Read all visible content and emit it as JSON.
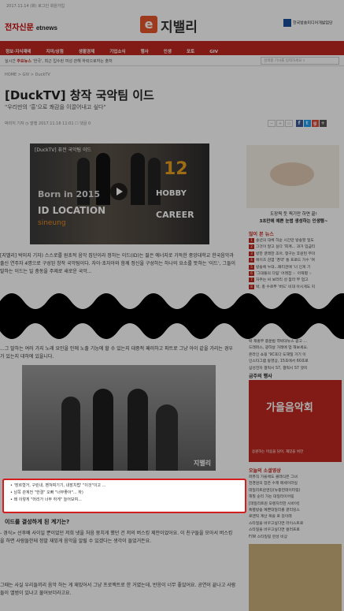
{
  "topbar": {
    "text": "2017.11.14 (화) 로그인 회원가입"
  },
  "header": {
    "etnews_logo": "전자신문",
    "etnews_sub": "etnews",
    "jibelli_mark": "e",
    "jibelli_name": "지밸리",
    "kocca": "한국방송미디어개발업단"
  },
  "nav": {
    "items": [
      "정보·지식재테",
      "지미/상점",
      "생활경제",
      "기업소식",
      "행사",
      "인생",
      "포토",
      "GIV"
    ]
  },
  "subnav": {
    "label": "실시간",
    "highlight": "주요뉴스",
    "text": "'한국', 최근 입수된 여성 관해 하락으로하는 출처",
    "search_placeholder": "검색할 기사를 입력하세요"
  },
  "breadcrumb": "HOME  >  GIV  >  DuckTV",
  "article": {
    "title": "[DuckTV] 창작 국악팀 이드",
    "subtitle": "\"우리만의 '흥'으로 쾌감을 이끌어내고 싶다\"",
    "meta": "박미지 기자   ◷ 발행 2017.11.16 11:01   ☐ 댓글 0",
    "video_title": "[DuckTV] 퓨전 국악팀 이드",
    "video_born": "Born in 2015",
    "video_id": "ID LOCATION",
    "video_sub": "sineung",
    "video_hobby": "HOBBY",
    "video_career": "CAREER",
    "video_num": "12",
    "paragraph1": "[지밸리] 박미지 기자) 스스로를 원초적 음악 집단이라 정하는 이드(ID)는 젊은 에너지로 가득한 중앙대학교 한국음악과 출신 연주자 4명으로 구성된 창작 국악팀이다. 자아·초자아와 함께 정신을 구성하는 하나의 요소를 뜻하는 '이드', 그들이 말하는 이드는 일 충동을 주제로 새로운 국악...",
    "paragraph2": "...그 말하는 여러 가지 노래 요인을 인에 노출 기능에 할 수 있는지 대중적 패러하고 파트로 그냥 아이 같을 가리는 경우가 있는지 대하에 있을니다.",
    "captions": [
      "'장르형거, 구린내, 벤쳐찌기기, 내장치법' \"이것\"이고 ...",
      "남쪽 관계전 \"한결\" 오빠 \"너무좋아\"... 하)",
      "왜 이렇게 \"머리가 너무 하게\" 늘어보여..."
    ],
    "section_heading": "이드를 결성하게 된 계기는?",
    "paragraph3": "- 경식> 선후배 사이일 뿐이었던 저희 넷을 처음 뭉치게 했던 건 저의 버스킹 제안이었어요. 이 친구들을 모아서 버스킹을 하면 사람들한테 정말 재밌게 음악을 알릴 수 있겠다는 생각이 들었거든요.",
    "paragraph4": "그때는 사실 우리들끼리 음악 하는 게 재밌어서 그냥 프로젝트로 한 거였는데, 반응이 너무 좋았어요. 공연이 끝나고 사람들이 앨범이 있냐고 물어보더라고요."
  },
  "sidebar": {
    "ad_title_1": "도장찍 듯 찍기만 하면 끝!",
    "ad_title_2": "3초만에 예쁜 눈썹 생성하는 인생템~",
    "popular_heading": "많이 본 뉴스",
    "popular": [
      "송년의 대체 하순 시간만 방송할 일도",
      "그것이 알고 싶다 '회계... 과거 입금티",
      "방한 글래한 조아, 항구는 후원된 무미",
      "에이즈 감염 '경약' 통 프로드 가수 '여",
      "방송에 누대...패티관에 '너 인게 기",
      "'그대들의 다림' 어레잡 ☞ 아재별 ☞",
      "자주는 씨 보라리 성 참라 부 업고",
      "박, 총 수르부 '버드' 비대 아시게도 지"
    ],
    "popular2": [
      "박 재홍부 중문법 역박대뉴스 광고 ...",
      "드래퍼스, 광하날 거래에 업 해보세요.",
      "온라인 쇼핑 '9C포다 도해밀 거기 이",
      "인스타그램 동영상, 15초에서 60초로",
      "삼성전자 갤럭시 S7, 갤럭시 S7 엣지",
      "케이아이비로 'ABS플러스'시스템",
      "실시간 '피조나니' 가입사 로 놀림"
    ],
    "promo_heading": "금주의 행사",
    "promo_text": "가을음악회",
    "promo_sub": "응원하는 마음을 담아, 재밌을 위한",
    "events_heading": "오늘의 소셜영상",
    "events": [
      "퍼뮤직 가을에도 클래식은 그녀",
      "천경원의 잡은 수제 매세이라실",
      "데일리트윈엔딩(뉴중헌데이터링)",
      "해질 순리 가는 대일리이어링",
      "[데일리트윈 오렌지라한 시바야]",
      "특별방송 예쁜대일리를 글리밍스",
      "로맨틱 계산 목을 로 길이래",
      "스타일을 바꾸고싶다면 라이스트로",
      "스타일을 바꾸고싶다면 컬러프로",
      "F/W 스타일링 완성 비상"
    ]
  },
  "colors": {
    "brand_red": "#c0281f",
    "caption_border": "#d21f1f",
    "jibelli_orange": "#e8542a"
  }
}
